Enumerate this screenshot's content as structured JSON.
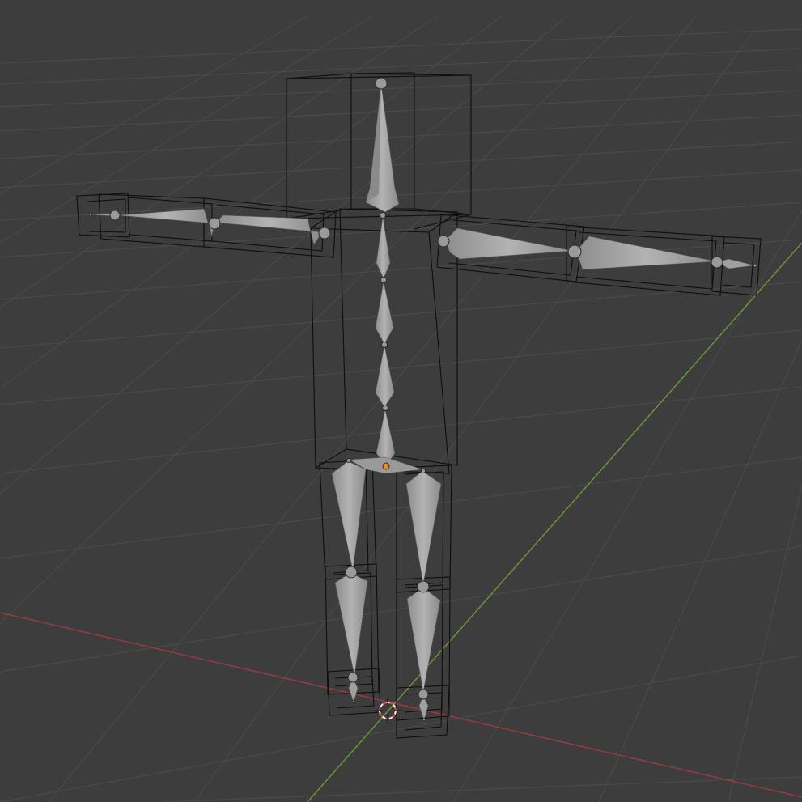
{
  "viewport": {
    "background": "#3d3d3d",
    "grid_color": "#4c4c4c",
    "x_axis_color": "#9c3b44",
    "y_axis_color": "#6d9a34",
    "wireframe_color": "#0e0e0e",
    "bone_color": "#a7a7a7",
    "bone_shade_color": "#8a8a8a",
    "active_joint_color": "#f08c1a",
    "cursor_ring_color": "#d64a4a"
  },
  "scene": {
    "object_type": "armature",
    "display": "octahedral",
    "bones": [
      "head",
      "spine-upper",
      "spine-mid",
      "spine-lower",
      "spine-base",
      "pelvis",
      "upper-arm-left",
      "forearm-left",
      "hand-left",
      "upper-arm-right",
      "forearm-right",
      "hand-right",
      "thigh-left",
      "shin-left",
      "foot-left",
      "thigh-right",
      "shin-right",
      "foot-right"
    ],
    "wireframe_parts": [
      "head-box",
      "torso-box",
      "upper-arm-left-box",
      "forearm-left-box",
      "hand-left-box",
      "upper-arm-right-box",
      "forearm-right-box",
      "hand-right-box",
      "thigh-left-box",
      "shin-left-box",
      "foot-left-box",
      "thigh-right-box",
      "shin-right-box",
      "foot-right-box"
    ]
  },
  "icons": {
    "cursor": "3d-cursor-icon"
  }
}
